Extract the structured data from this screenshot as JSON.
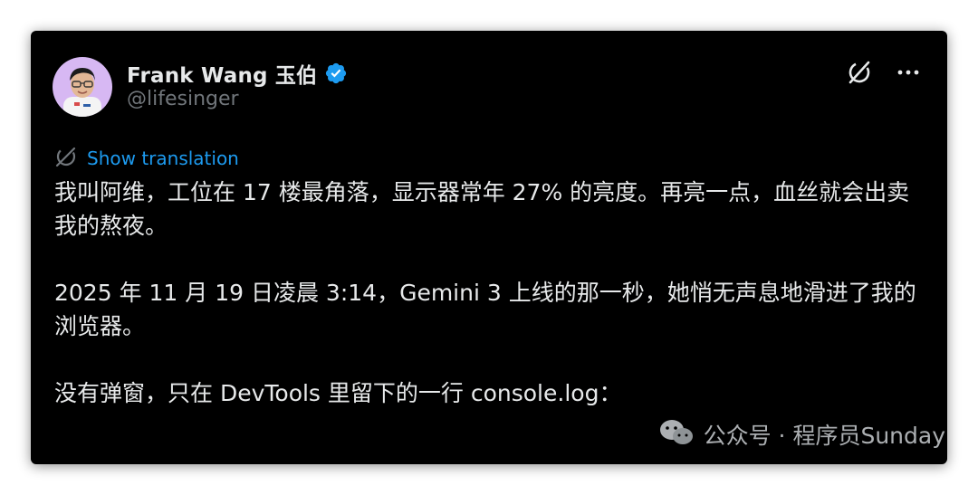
{
  "author": {
    "display_name": "Frank Wang 玉伯",
    "handle": "@lifesinger",
    "verified": true,
    "avatar_bg": "#d7b8f3"
  },
  "header_icons": {
    "grok": "grok-icon",
    "more": "more-icon"
  },
  "translation": {
    "icon": "translate-icon",
    "label": "Show translation"
  },
  "tweet": {
    "paragraphs": [
      "我叫阿维，工位在 17 楼最角落，显示器常年 27% 的亮度。再亮一点，血丝就会出卖我的熬夜。",
      "2025 年 11 月 19 日凌晨 3:14，Gemini 3 上线的那一秒，她悄无声息地滑进了我的浏览器。",
      "没有弹窗，只在 DevTools 里留下的一行 console.log："
    ]
  },
  "watermark": {
    "icon": "wechat-icon",
    "text": "公众号 · 程序员Sunday"
  },
  "colors": {
    "background": "#000000",
    "text_primary": "#e7e9ea",
    "text_secondary": "#71767b",
    "accent": "#1d9bf0"
  }
}
